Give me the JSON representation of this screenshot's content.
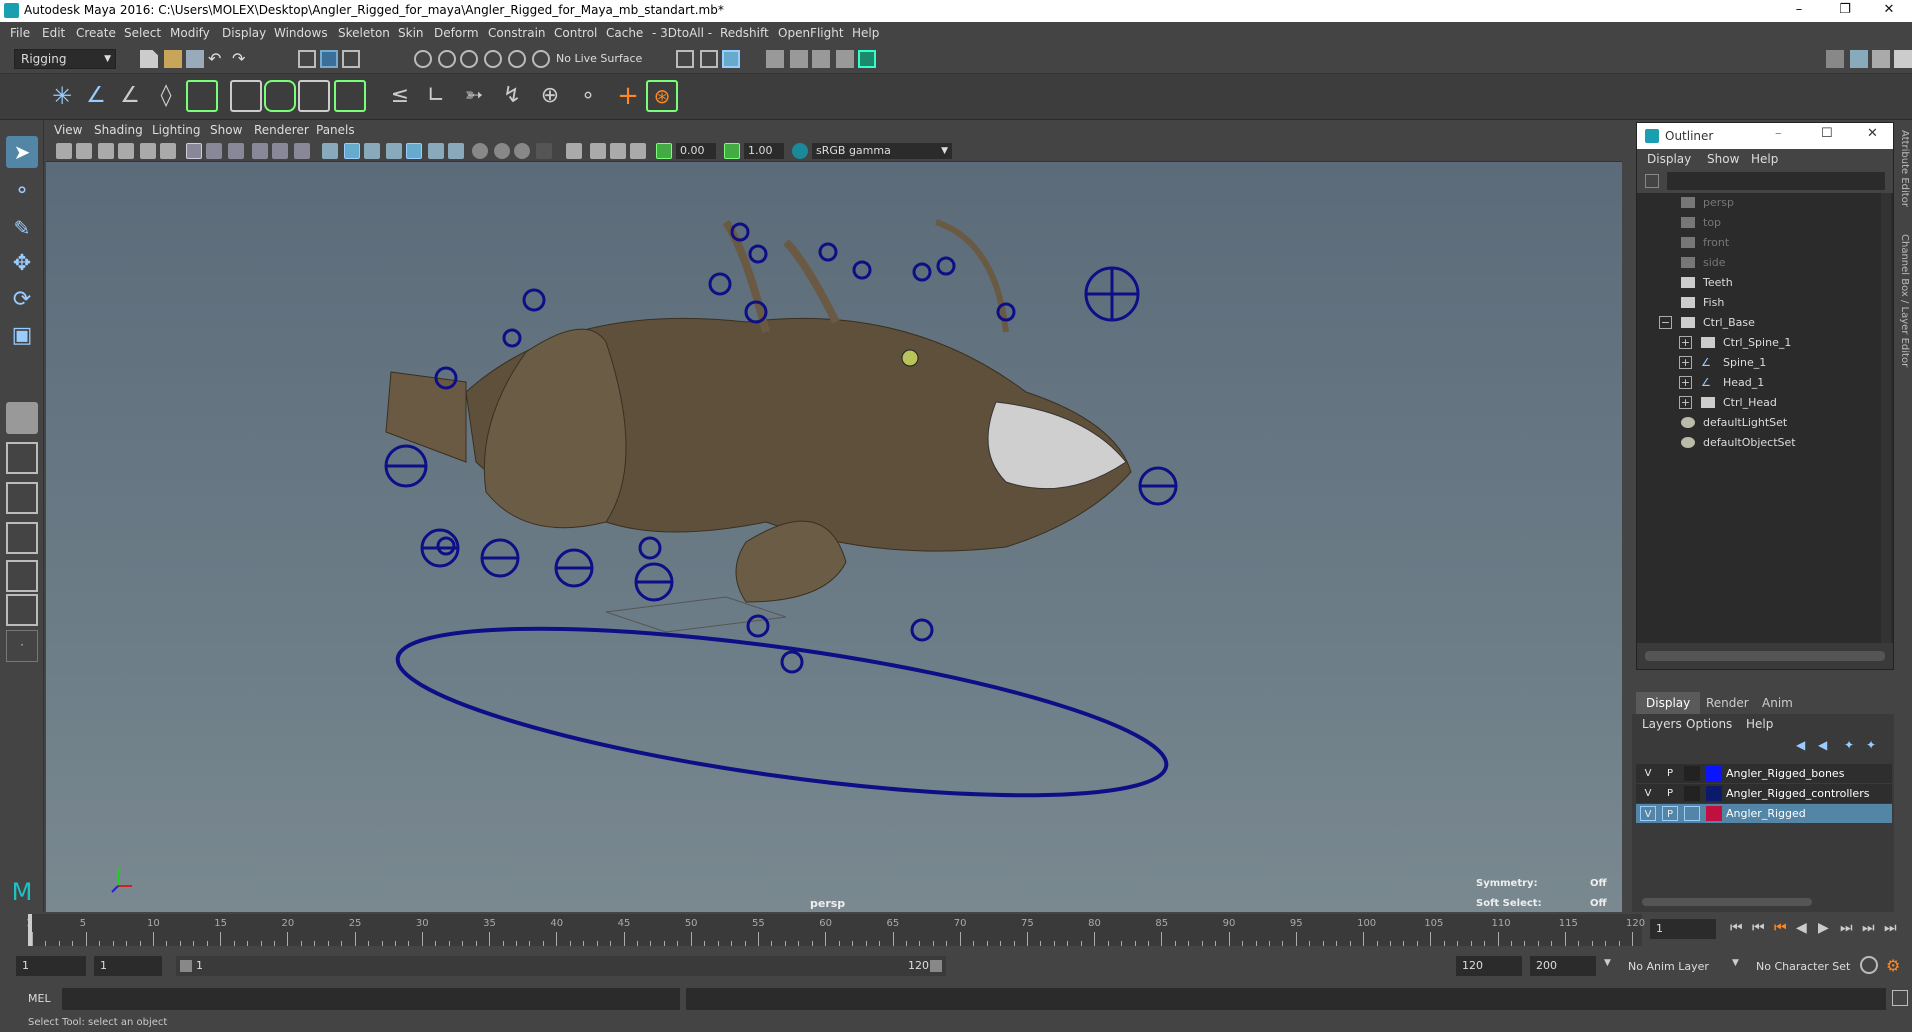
{
  "window": {
    "title": "Autodesk Maya 2016: C:\\Users\\MOLEX\\Desktop\\Angler_Rigged_for_maya\\Angler_Rigged_for_Maya_mb_standart.mb*"
  },
  "menubar": [
    "File",
    "Edit",
    "Create",
    "Select",
    "Modify",
    "Display",
    "Windows",
    "Skeleton",
    "Skin",
    "Deform",
    "Constrain",
    "Control",
    "Cache",
    "- 3DtoAll -",
    "Redshift",
    "OpenFlight",
    "Help"
  ],
  "statusline": {
    "mode": "Rigging",
    "live_surface": "No Live Surface"
  },
  "viewport": {
    "menu": [
      "View",
      "Shading",
      "Lighting",
      "Show",
      "Renderer",
      "Panels"
    ],
    "exposure": "0.00",
    "gamma": "1.00",
    "color_space": "sRGB gamma",
    "camera_label": "persp",
    "symmetry_label": "Symmetry:",
    "symmetry_value": "Off",
    "soft_select_label": "Soft Select:",
    "soft_select_value": "Off"
  },
  "outliner": {
    "title": "Outliner",
    "menu": [
      "Display",
      "Show",
      "Help"
    ],
    "items": [
      {
        "label": "persp",
        "type": "camera",
        "dim": true
      },
      {
        "label": "top",
        "type": "camera",
        "dim": true
      },
      {
        "label": "front",
        "type": "camera",
        "dim": true
      },
      {
        "label": "side",
        "type": "camera",
        "dim": true
      },
      {
        "label": "Teeth",
        "type": "mesh",
        "dim": false
      },
      {
        "label": "Fish",
        "type": "mesh",
        "dim": false
      },
      {
        "label": "Ctrl_Base",
        "type": "mesh",
        "dim": false
      },
      {
        "label": "Ctrl_Spine_1",
        "type": "mesh",
        "dim": false
      },
      {
        "label": "Spine_1",
        "type": "joint",
        "dim": false
      },
      {
        "label": "Head_1",
        "type": "joint",
        "dim": false
      },
      {
        "label": "Ctrl_Head",
        "type": "mesh",
        "dim": false
      },
      {
        "label": "defaultLightSet",
        "type": "set",
        "dim": false
      },
      {
        "label": "defaultObjectSet",
        "type": "set",
        "dim": false
      }
    ]
  },
  "side_tabs": [
    "Attribute Editor",
    "Channel Box / Layer Editor"
  ],
  "layer_editor": {
    "tabs": [
      "Display",
      "Render",
      "Anim"
    ],
    "active_tab": "Display",
    "menu": [
      "Layers",
      "Options",
      "Help"
    ],
    "layers": [
      {
        "v": "V",
        "p": "P",
        "name": "Angler_Rigged_bones",
        "color": "#0a14ff",
        "active": false
      },
      {
        "v": "V",
        "p": "P",
        "name": "Angler_Rigged_controllers",
        "color": "#0b1a6b",
        "active": false
      },
      {
        "v": "V",
        "p": "P",
        "name": "Angler_Rigged",
        "color": "#c01040",
        "active": true
      }
    ]
  },
  "timeline": {
    "ticks": [
      "1",
      "5",
      "10",
      "15",
      "20",
      "25",
      "30",
      "35",
      "40",
      "45",
      "50",
      "55",
      "60",
      "65",
      "70",
      "75",
      "80",
      "85",
      "90",
      "95",
      "100",
      "105",
      "110",
      "115",
      "120"
    ],
    "current_frame": "1"
  },
  "range": {
    "start": "1",
    "anim_start": "1",
    "slider_start": "1",
    "slider_end": "120",
    "end": "120",
    "anim_end": "200",
    "anim_layer": "No Anim Layer",
    "char_set": "No Character Set"
  },
  "cmdline": {
    "label": "MEL"
  },
  "helpline": "Select Tool: select an object"
}
